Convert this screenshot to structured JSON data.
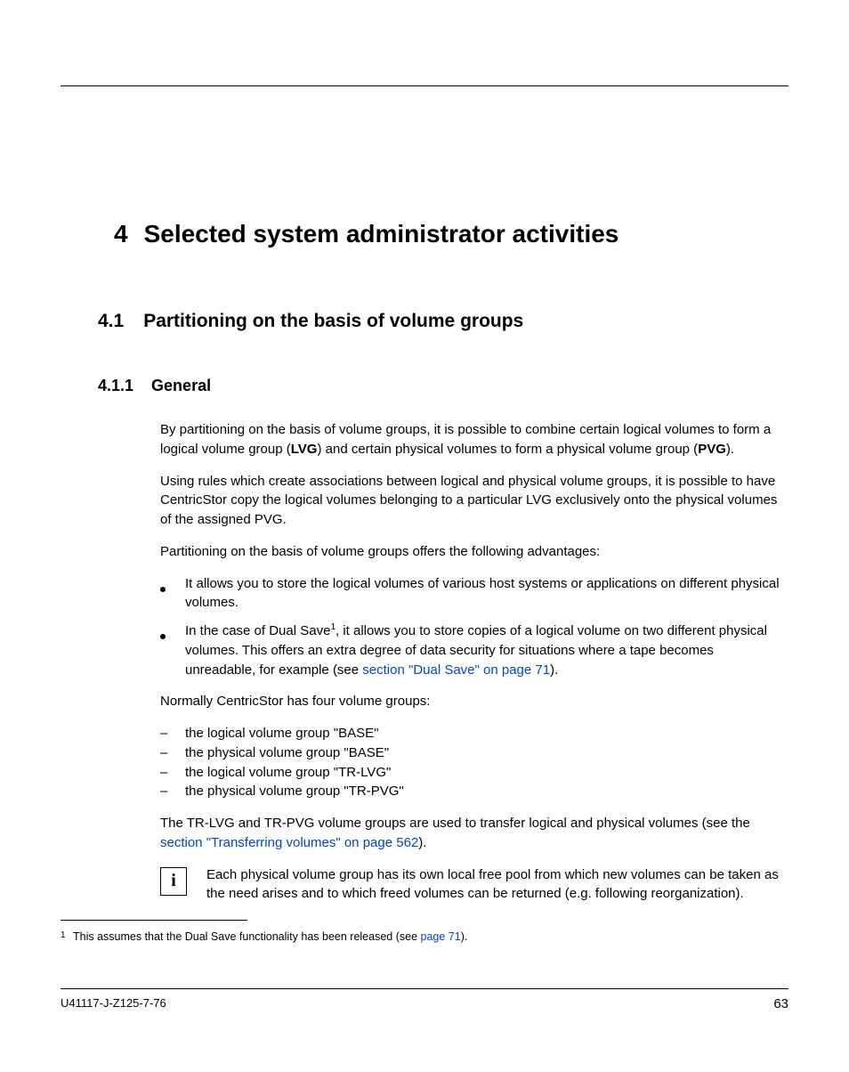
{
  "chapter": {
    "number": "4",
    "title": "Selected system administrator activities"
  },
  "section": {
    "number": "4.1",
    "title": "Partitioning on the basis of volume groups"
  },
  "subsection": {
    "number": "4.1.1",
    "title": "General"
  },
  "para1_a": "By partitioning on the basis of volume groups, it is possible to combine certain logical volumes to form a logical volume group (",
  "para1_lvg": "LVG",
  "para1_b": ") and certain physical volumes to form a physical volume group (",
  "para1_pvg": "PVG",
  "para1_c": ").",
  "para2": "Using rules which create associations between logical and physical volume groups, it is possible to have CentricStor copy the logical volumes belonging to a particular LVG exclusively onto the physical volumes of the assigned PVG.",
  "para3": "Partitioning on the basis of volume groups offers the following advantages:",
  "bullets": [
    {
      "text": "It allows you to store the logical volumes of various host systems or applications on different physical volumes."
    },
    {
      "a": "In the case of Dual Save",
      "sup": "1",
      "b": ", it allows you to store copies of a logical volume on two different physical volumes. This offers an extra degree of data security for situations where a tape becomes unreadable, for example (see ",
      "link": "section \"Dual Save\" on page 71",
      "c": ")."
    }
  ],
  "para4": "Normally CentricStor has four volume groups:",
  "dash_mark": "–",
  "dashes": [
    "the logical volume group \"BASE\"",
    "the physical volume group \"BASE\"",
    "the logical volume group \"TR-LVG\"",
    "the physical volume group \"TR-PVG\""
  ],
  "para5_a": "The TR-LVG and TR-PVG volume groups are used to transfer logical and physical volumes (see the ",
  "para5_link": "section \"Transferring volumes\" on page 562",
  "para5_b": ").",
  "info_glyph": "i",
  "info_text": "Each physical volume group has its own local free pool from which new volumes can be taken as the need arises and to which freed volumes can be returned (e.g. following reorganization).",
  "footnote": {
    "mark": "1",
    "a": "This assumes that the Dual Save functionality has been released (see ",
    "link": "page 71",
    "b": ")."
  },
  "footer": {
    "doc_id": "U41117-J-Z125-7-76",
    "page": "63"
  }
}
